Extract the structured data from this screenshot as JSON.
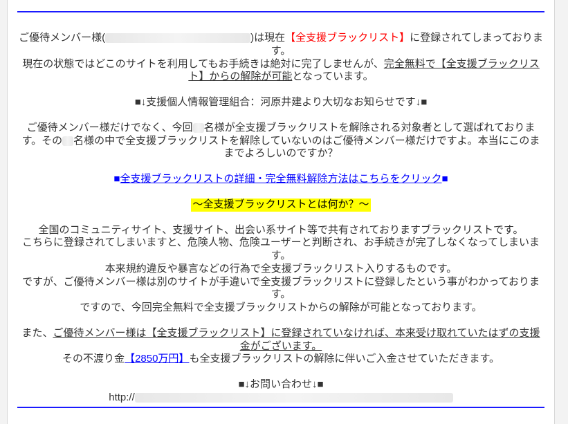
{
  "intro": {
    "prefix": "ご優待メンバー様(",
    "suffix_before_red": ")は現在",
    "red_bracket": "【全支援ブラックリスト】",
    "suffix_after_red": "に登録されてしまっております。"
  },
  "line2": {
    "before": "現在の状態ではどこのサイトを利用してもお手続きは絶対に完了しませんが、",
    "underline": "完全無料で【全支援ブラックリスト】からの解除が可能",
    "after": "となっています。"
  },
  "line3": "■↓支援個人情報管理組合：河原井建より大切なお知らせです↓■",
  "line4a_before": "ご優待メンバー様だけでなく、今回",
  "line4a_after": "名様が全支援ブラックリストを解除される対象者として選ばれております。その",
  "line4b": "名様の中で全支援ブラックリストを解除していないのはご優待メンバー様だけですよ。本当にこのままでよろしいのですか？",
  "link_line": {
    "before_box": "■",
    "link_text": "全支援ブラックリストの詳細・完全無料解除方法はこちらをクリック",
    "after_box": "■"
  },
  "yellow_line": "〜全支援ブラックリストとは何か？〜",
  "desc1": "全国のコミュニティサイト、支援サイト、出会い系サイト等で共有されておりますブラックリストです。",
  "desc2": "こちらに登録されてしまいますと、危険人物、危険ユーザーと判断され、お手続きが完了しなくなってしまいます。",
  "desc3": "本来規約違反や暴言などの行為で全支援ブラックリスト入りするものです。",
  "desc4": "ですが、ご優待メンバー様は別のサイトが手違いで全支援ブラックリストに登録したという事がわかっております。",
  "desc5": "ですので、今回完全無料で全支援ブラックリストからの解除が可能となっております。",
  "bonus": {
    "before": "また、",
    "underline": "ご優待メンバー様は【全支援ブラックリスト】に登録されていなければ、本来受け取れていたはずの支援金がございます。"
  },
  "money_line": {
    "before": "その不渡り金",
    "amount": "【2850万円】",
    "after": "も全支援ブラックリストの解除に伴いご入金させていただきます。"
  },
  "contact_header": "■↓お問い合わせ↓■",
  "url_prefix": "http://"
}
